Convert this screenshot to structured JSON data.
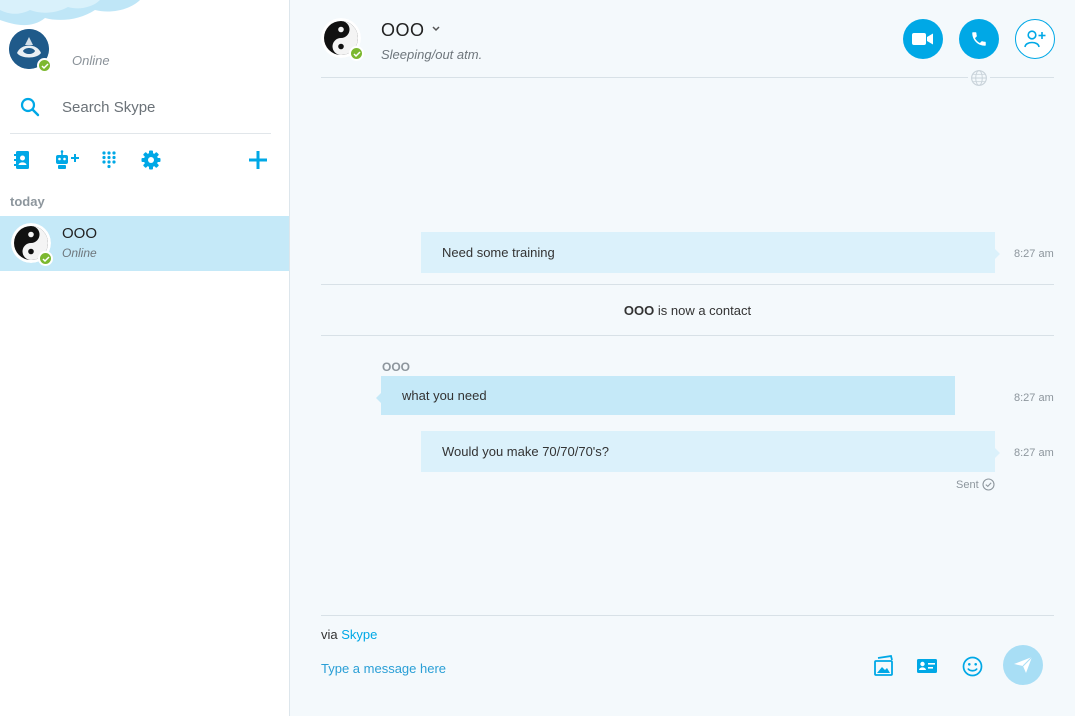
{
  "sidebar": {
    "self_status": "Online",
    "search_placeholder": "Search Skype",
    "toolbar": {
      "icons": [
        "contacts-icon",
        "add-bot-icon",
        "dialpad-icon",
        "settings-icon",
        "plus-icon"
      ]
    },
    "recent_header": "today",
    "conversation": {
      "name": "OOO",
      "status": "Online"
    }
  },
  "chat": {
    "contact_name": "OOO",
    "contact_mood": "Sleeping/out atm.",
    "messages": [
      {
        "direction": "out",
        "text": "Need some training",
        "time": "8:27 am"
      },
      {
        "direction": "in",
        "sender": "OOO",
        "text": "what you need",
        "time": "8:27 am"
      },
      {
        "direction": "out",
        "text": "Would you make 70/70/70's?",
        "time": "8:27 am",
        "status": "Sent"
      }
    ],
    "system_message": {
      "name": "OOO",
      "text": "is now a contact"
    }
  },
  "compose": {
    "via_prefix": "via",
    "via_link": "Skype",
    "placeholder": "Type a message here"
  },
  "colors": {
    "accent": "#00a8e6",
    "presence": "#7cb82f",
    "selected": "#c5e9f8",
    "outgoing_bubble": "#dbf1fb",
    "incoming_bubble": "#c5e9f8"
  }
}
